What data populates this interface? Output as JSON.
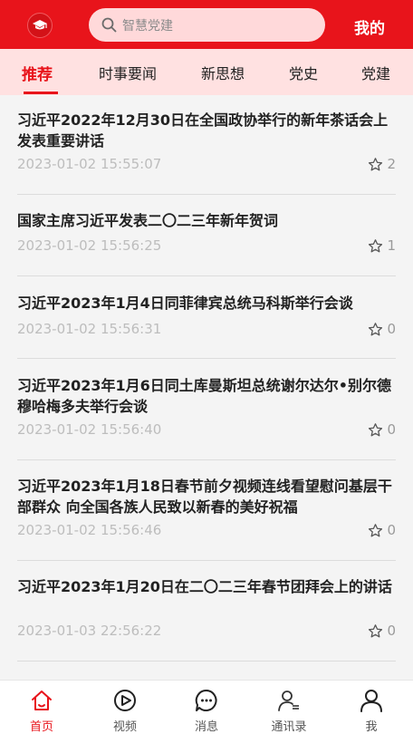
{
  "header": {
    "search_placeholder": "智慧党建",
    "mine_label": "我的"
  },
  "tabs": [
    {
      "label": "推荐",
      "active": true
    },
    {
      "label": "时事要闻",
      "active": false
    },
    {
      "label": "新思想",
      "active": false
    },
    {
      "label": "党史",
      "active": false
    },
    {
      "label": "党建",
      "active": false
    }
  ],
  "articles": [
    {
      "title": "习近平2022年12月30日在全国政协举行的新年茶话会上发表重要讲话",
      "date": "2023-01-02 15:55:07",
      "stars": "2"
    },
    {
      "title": "国家主席习近平发表二〇二三年新年贺词",
      "date": "2023-01-02 15:56:25",
      "stars": "1"
    },
    {
      "title": "习近平2023年1月4日同菲律宾总统马科斯举行会谈",
      "date": "2023-01-02 15:56:31",
      "stars": "0"
    },
    {
      "title": "习近平2023年1月6日同土库曼斯坦总统谢尔达尔•别尔德穆哈梅多夫举行会谈",
      "date": "2023-01-02 15:56:40",
      "stars": "0"
    },
    {
      "title": "习近平2023年1月18日春节前夕视频连线看望慰问基层干部群众 向全国各族人民致以新春的美好祝福",
      "date": "2023-01-02 15:56:46",
      "stars": "0"
    },
    {
      "title": "习近平2023年1月20日在二〇二三年春节团拜会上的讲话",
      "date": "2023-01-03 22:56:22",
      "stars": "0"
    }
  ],
  "bottom_nav": [
    {
      "label": "首页",
      "icon": "home-icon",
      "active": true
    },
    {
      "label": "视频",
      "icon": "play-icon",
      "active": false
    },
    {
      "label": "消息",
      "icon": "message-icon",
      "active": false
    },
    {
      "label": "通讯录",
      "icon": "contacts-icon",
      "active": false
    },
    {
      "label": "我",
      "icon": "user-icon",
      "active": false
    }
  ],
  "colors": {
    "brand_red": "#e8141b",
    "tab_bar_bg": "#ffe1e1",
    "search_bg": "#ffd9da"
  }
}
